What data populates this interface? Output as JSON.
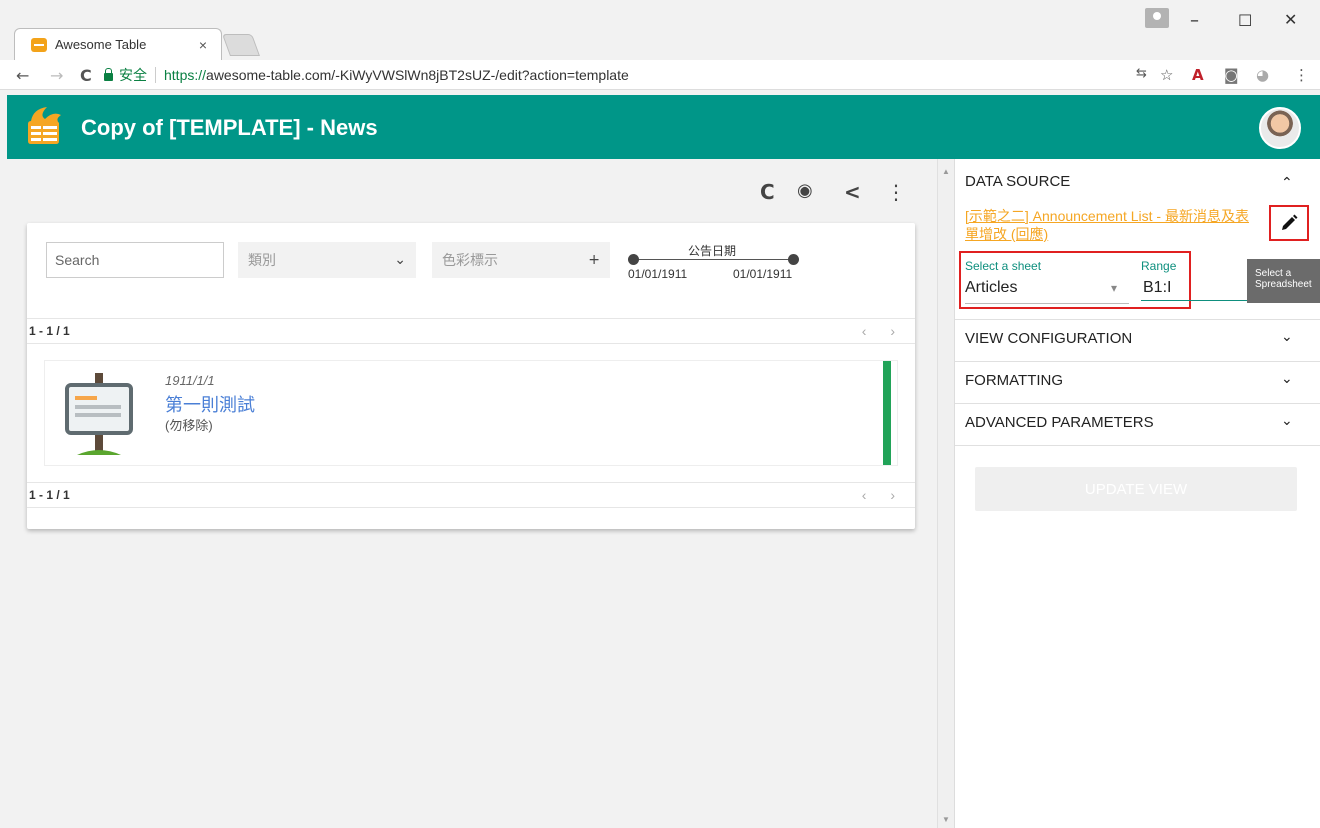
{
  "browser": {
    "tab_title": "Awesome Table",
    "tab_close": "×",
    "secure_label": "安全",
    "url_protocol": "https://",
    "url_rest": "awesome-table.com/-KiWyVWSlWn8jBT2sUZ-/edit?action=template",
    "window_controls": {
      "minimize": "–",
      "maximize": "☐",
      "close": "✕"
    },
    "nav": {
      "back": "←",
      "forward": "→",
      "reload": "C"
    },
    "extensions": {
      "translate": "⇆",
      "star": "☆",
      "pdf": "A",
      "camera": "◙",
      "vault": "◕",
      "menu": "⋮"
    }
  },
  "header": {
    "title": "Copy of [TEMPLATE] - News"
  },
  "preview": {
    "toolbar": {
      "refresh": "C",
      "preview": "◉",
      "share": "<",
      "more": "⋮"
    },
    "search": {
      "placeholder": "Search"
    },
    "filters": [
      {
        "label": "類別",
        "control": "⌄"
      },
      {
        "label": "色彩標示",
        "control": "+"
      }
    ],
    "date_range": {
      "label": "公告日期",
      "start": "01/01/1911",
      "end": "01/01/1911"
    },
    "pager": {
      "top": "1 - 1 / 1",
      "bottom": "1 - 1 / 1",
      "arrows": "‹ ›"
    },
    "item": {
      "date": "1911/1/1",
      "title": "第一則測試",
      "description": "(勿移除)",
      "color": "#21a358"
    }
  },
  "sidebar": {
    "data_source": {
      "title": "DATA SOURCE",
      "chevron": "⌃",
      "spreadsheet_link": "[示範之二] Announcement List - 最新消息及表單增改 (回應)",
      "edit_icon": "pencil-icon",
      "sheet_label": "Select a sheet",
      "sheet_value": "Articles",
      "sheet_dropdown": "▾",
      "range_label": "Range",
      "range_value": "B1:I",
      "tooltip": "Select a Spreadsheet"
    },
    "sections": [
      {
        "title": "VIEW CONFIGURATION",
        "chevron": "⌄"
      },
      {
        "title": "FORMATTING",
        "chevron": "⌄"
      },
      {
        "title": "ADVANCED PARAMETERS",
        "chevron": "⌄"
      }
    ],
    "update_button": "UPDATE VIEW"
  },
  "colors": {
    "header": "#009688",
    "accent": "#f5a623",
    "highlight": "#e02020",
    "teal_text": "#0e8f7e"
  }
}
